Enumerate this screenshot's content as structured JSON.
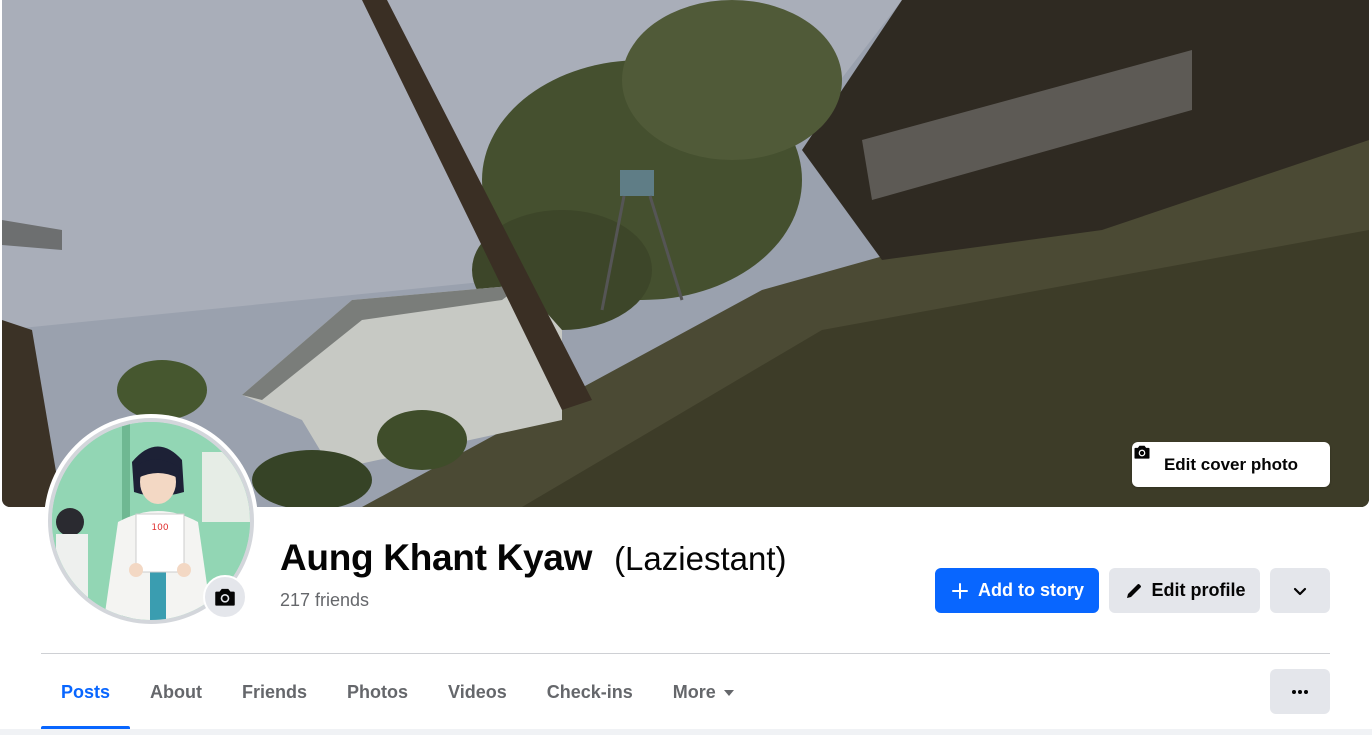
{
  "profile": {
    "name": "Aung Khant Kyaw",
    "alternate_name": "(Laziestant)",
    "friends_count_text": "217 friends"
  },
  "cover": {
    "edit_cover_label": "Edit cover photo",
    "icon": "camera-icon"
  },
  "avatar": {
    "icon": "camera-icon",
    "badge_text": "100"
  },
  "actions": {
    "add_to_story_label": "Add to story",
    "edit_profile_label": "Edit profile",
    "add_icon": "plus-icon",
    "edit_icon": "pencil-icon",
    "dropdown_icon": "chevron-down-icon"
  },
  "tabs": [
    {
      "label": "Posts",
      "active": true
    },
    {
      "label": "About",
      "active": false
    },
    {
      "label": "Friends",
      "active": false
    },
    {
      "label": "Photos",
      "active": false
    },
    {
      "label": "Videos",
      "active": false
    },
    {
      "label": "Check-ins",
      "active": false
    },
    {
      "label": "More",
      "active": false,
      "has_caret": true
    }
  ],
  "more_options_icon": "ellipsis-icon",
  "colors": {
    "accent": "#0866ff",
    "secondary_button": "#e4e6eb",
    "muted_text": "#65676b",
    "text": "#050505"
  }
}
